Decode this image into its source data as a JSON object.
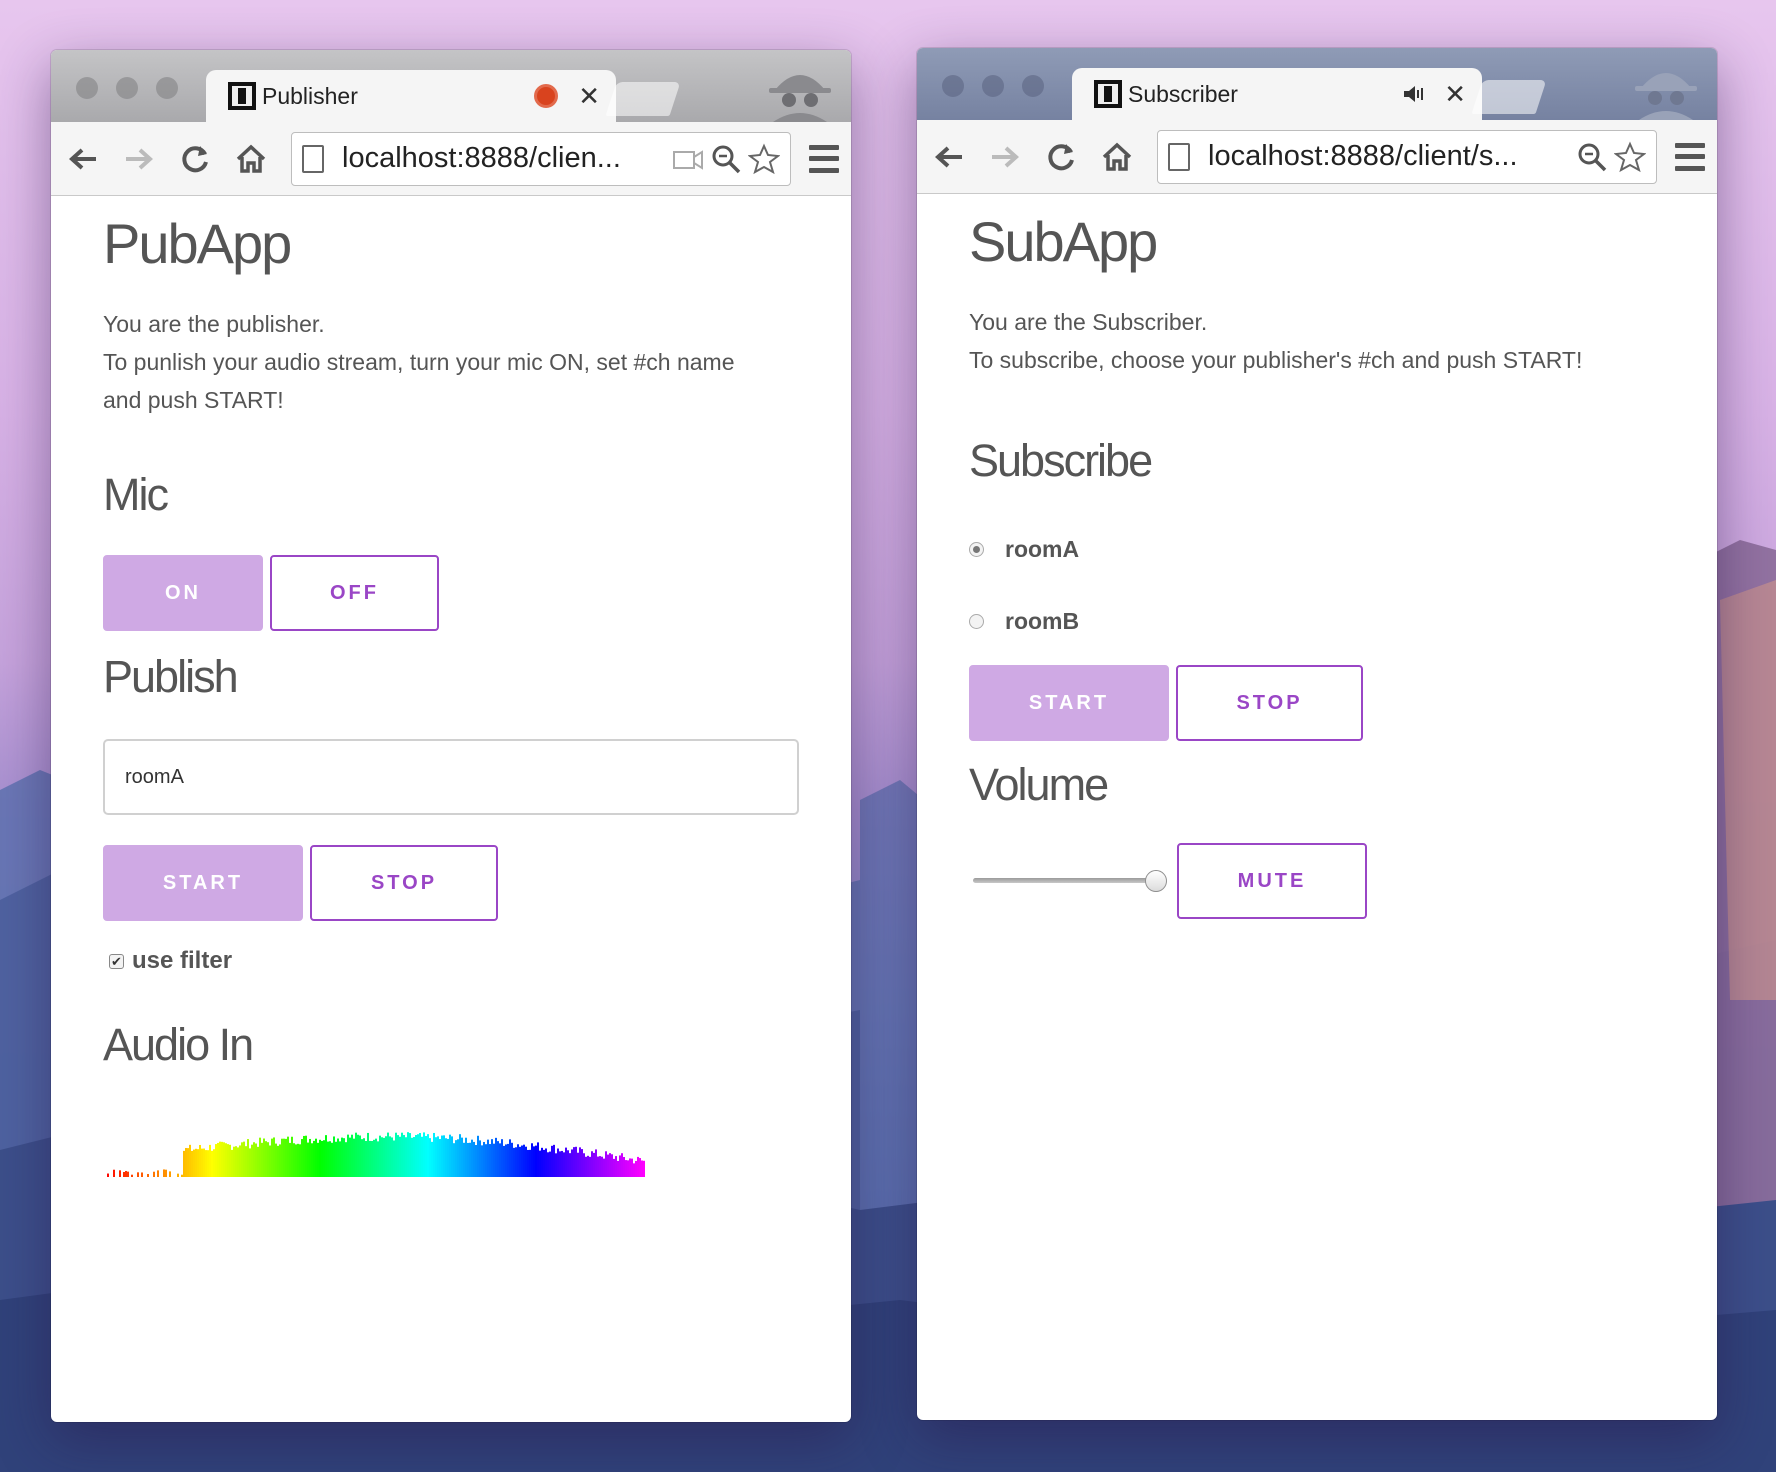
{
  "publisher": {
    "tab_title": "Publisher",
    "url": "localhost:8888/clien...",
    "app_title": "PubApp",
    "desc_line1": "You are the publisher.",
    "desc_line2": "To punlish your audio stream, turn your mic ON, set #ch name",
    "desc_line3": "and push START!",
    "mic_heading": "Mic",
    "mic_on_label": "ON",
    "mic_off_label": "OFF",
    "publish_heading": "Publish",
    "channel_value": "roomA",
    "start_label": "START",
    "stop_label": "STOP",
    "filter_label": "use filter",
    "filter_checked": true,
    "audio_heading": "Audio In"
  },
  "subscriber": {
    "tab_title": "Subscriber",
    "url": "localhost:8888/client/s...",
    "app_title": "SubApp",
    "desc_line1": "You are the Subscriber.",
    "desc_line2": "To subscribe, choose your publisher's #ch and push START!",
    "subscribe_heading": "Subscribe",
    "rooms": [
      {
        "label": "roomA",
        "checked": true
      },
      {
        "label": "roomB",
        "checked": false
      }
    ],
    "start_label": "START",
    "stop_label": "STOP",
    "volume_heading": "Volume",
    "volume_level": 1.0,
    "mute_label": "MUTE"
  },
  "theme": {
    "accent": "#9a46c6",
    "accent_fill": "#cfa9e4",
    "text": "#555555"
  },
  "icons": [
    "back-icon",
    "forward-icon",
    "reload-icon",
    "home-icon",
    "page-icon",
    "camera-icon",
    "zoom-icon",
    "star-icon",
    "menu-icon",
    "recording-icon",
    "speaker-icon",
    "close-icon",
    "incognito-icon"
  ]
}
